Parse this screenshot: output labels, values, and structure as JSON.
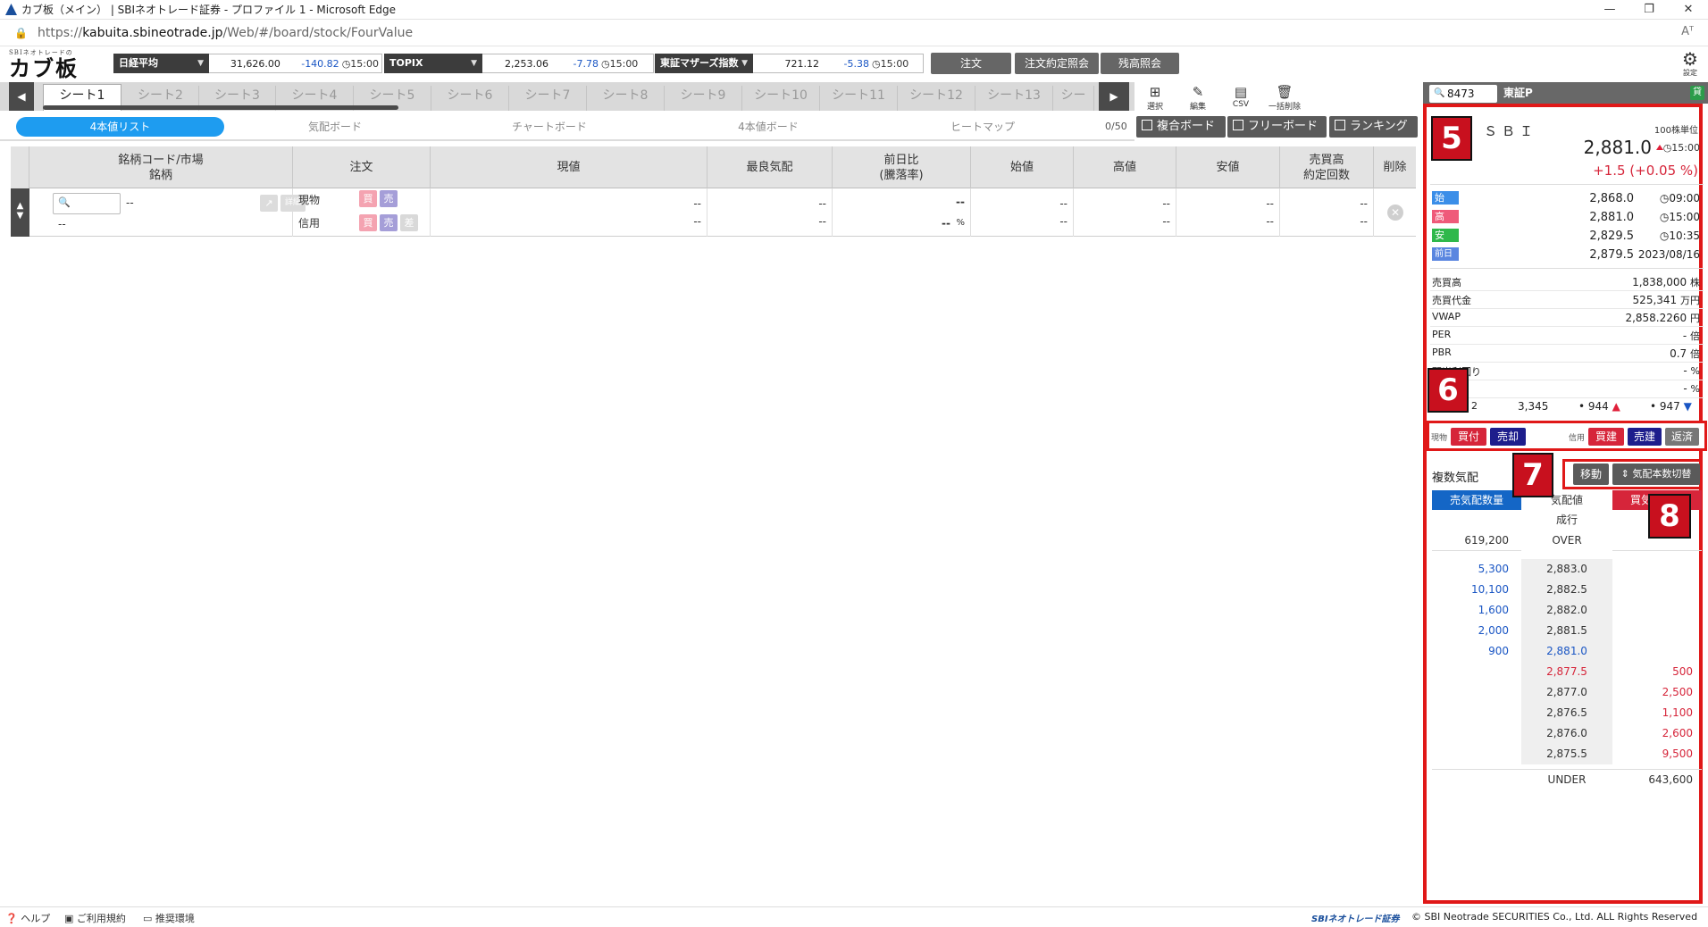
{
  "window": {
    "title": "カブ板（メイン） | SBIネオトレード証券 - プロファイル 1 - Microsoft Edge",
    "min": "—",
    "restore": "❐",
    "close": "✕"
  },
  "address": {
    "prefix": "https://",
    "host": "kabuita.sbineotrade.jp",
    "path": "/Web/#/board/stock/FourValue",
    "reader": "Aᵀ"
  },
  "logo": {
    "sub": "SBIネオトレードの",
    "main": "カブ板"
  },
  "indices": [
    {
      "name": "日経平均",
      "value": "31,626.00",
      "change": "-140.82",
      "time": "15:00"
    },
    {
      "name": "TOPIX",
      "value": "2,253.06",
      "change": "-7.78",
      "time": "15:00"
    },
    {
      "name": "東証マザーズ指数",
      "value": "721.12",
      "change": "-5.38",
      "time": "15:00"
    }
  ],
  "header_buttons": {
    "order": "注文",
    "execution": "注文約定照会",
    "balance": "残高照会",
    "settings": "設定"
  },
  "tabs": [
    "シート1",
    "シート2",
    "シート3",
    "シート4",
    "シート5",
    "シート6",
    "シート7",
    "シート8",
    "シート9",
    "シート10",
    "シート11",
    "シート12",
    "シート13",
    "シー"
  ],
  "tools": {
    "select": "選択",
    "edit": "編集",
    "csv": "CSV",
    "delete_all": "一括削除"
  },
  "subnav": {
    "four_value": "4本値リスト",
    "quote_board": "気配ボード",
    "chart_board": "チャートボード",
    "four_value_board": "4本値ボード",
    "heatmap": "ヒートマップ",
    "count": "0/50"
  },
  "open_buttons": {
    "composite": "複合ボード",
    "free": "フリーボード",
    "ranking": "ランキング"
  },
  "table": {
    "headers": {
      "code_l1": "銘柄コード/市場",
      "code_l2": "銘柄",
      "order": "注文",
      "price": "現値",
      "best": "最良気配",
      "prev_l1": "前日比",
      "prev_l2": "(騰落率)",
      "open": "始値",
      "high": "高値",
      "low": "安値",
      "vol_l1": "売買高",
      "vol_l2": "約定回数",
      "delete": "削除"
    },
    "row": {
      "code": "--",
      "name": "--",
      "detail": "詳細",
      "cash": "現物",
      "margin": "信用",
      "buy": "買",
      "sell": "売",
      "diff": "差",
      "price1": "--",
      "price2": "--",
      "best1": "--",
      "best2": "--",
      "chg1": "--",
      "chg2": "--",
      "pct": "%",
      "open1": "--",
      "open2": "--",
      "high1": "--",
      "high2": "--",
      "low1": "--",
      "low2": "--",
      "vol1": "--",
      "vol2": "--"
    }
  },
  "panel": {
    "code": "8473",
    "market": "東証P",
    "tag": "貸",
    "name": "ＳＢＩ",
    "unit": "100株単位",
    "price": "2,881.0",
    "price_time": "15:00",
    "change": "+1.5 (+0.05 %)",
    "ohlc": [
      {
        "label": "始",
        "value": "2,868.0",
        "time": "09:00",
        "color": "#3b8ee8"
      },
      {
        "label": "高",
        "value": "2,881.0",
        "time": "15:00",
        "color": "#ef5a7a"
      },
      {
        "label": "安",
        "value": "2,829.5",
        "time": "10:35",
        "color": "#2fb84b"
      },
      {
        "label": "前日",
        "value": "2,879.5",
        "time": "2023/08/16",
        "color": "#5a86e0"
      }
    ],
    "stats": [
      {
        "label": "売買高",
        "value": "1,838,000",
        "unit": "株"
      },
      {
        "label": "売買代金",
        "value": "525,341",
        "unit": "万円"
      },
      {
        "label": "VWAP",
        "value": "2,858.2260",
        "unit": "円"
      },
      {
        "label": "PER",
        "value": "-",
        "unit": "倍"
      },
      {
        "label": "PBR",
        "value": "0.7",
        "unit": "倍"
      },
      {
        "label": "配当利回り",
        "value": "-",
        "unit": "%"
      },
      {
        "label": "",
        "value": "-",
        "unit": "%"
      }
    ],
    "extra": {
      "label": "2",
      "v1": "3,345",
      "v2": "944",
      "v3": "947"
    },
    "order": {
      "cash_label": "現物",
      "buy": "買付",
      "sell": "売却",
      "margin_label": "信用",
      "mbuy": "買建",
      "msell": "売建",
      "repay": "返済"
    },
    "multi_quote": "複数気配",
    "move": "移動",
    "toggle": "気配本数切替",
    "book_head": {
      "sell_qty": "売気配数量",
      "price": "気配値",
      "buy_qty": "買気配数量"
    },
    "market_order": "成行",
    "over": {
      "qty": "619,200",
      "label": "OVER"
    },
    "asks": [
      {
        "qty": "5,300",
        "price": "2,883.0"
      },
      {
        "qty": "10,100",
        "price": "2,882.5"
      },
      {
        "qty": "1,600",
        "price": "2,882.0"
      },
      {
        "qty": "2,000",
        "price": "2,881.5"
      },
      {
        "qty": "900",
        "price": "2,881.0"
      }
    ],
    "bids": [
      {
        "price": "2,877.5",
        "qty": "500"
      },
      {
        "price": "2,877.0",
        "qty": "2,500"
      },
      {
        "price": "2,876.5",
        "qty": "1,100"
      },
      {
        "price": "2,876.0",
        "qty": "2,600"
      },
      {
        "price": "2,875.5",
        "qty": "9,500"
      }
    ],
    "under": {
      "label": "UNDER",
      "qty": "643,600"
    },
    "badges": [
      "5",
      "6",
      "7",
      "8"
    ]
  },
  "footer": {
    "help": "ヘルプ",
    "terms": "ご利用規約",
    "env": "推奨環境",
    "brand": "SBIネオトレード証券",
    "copyright": "© SBI Neotrade SECURITIES Co., Ltd. ALL Rights Reserved"
  }
}
